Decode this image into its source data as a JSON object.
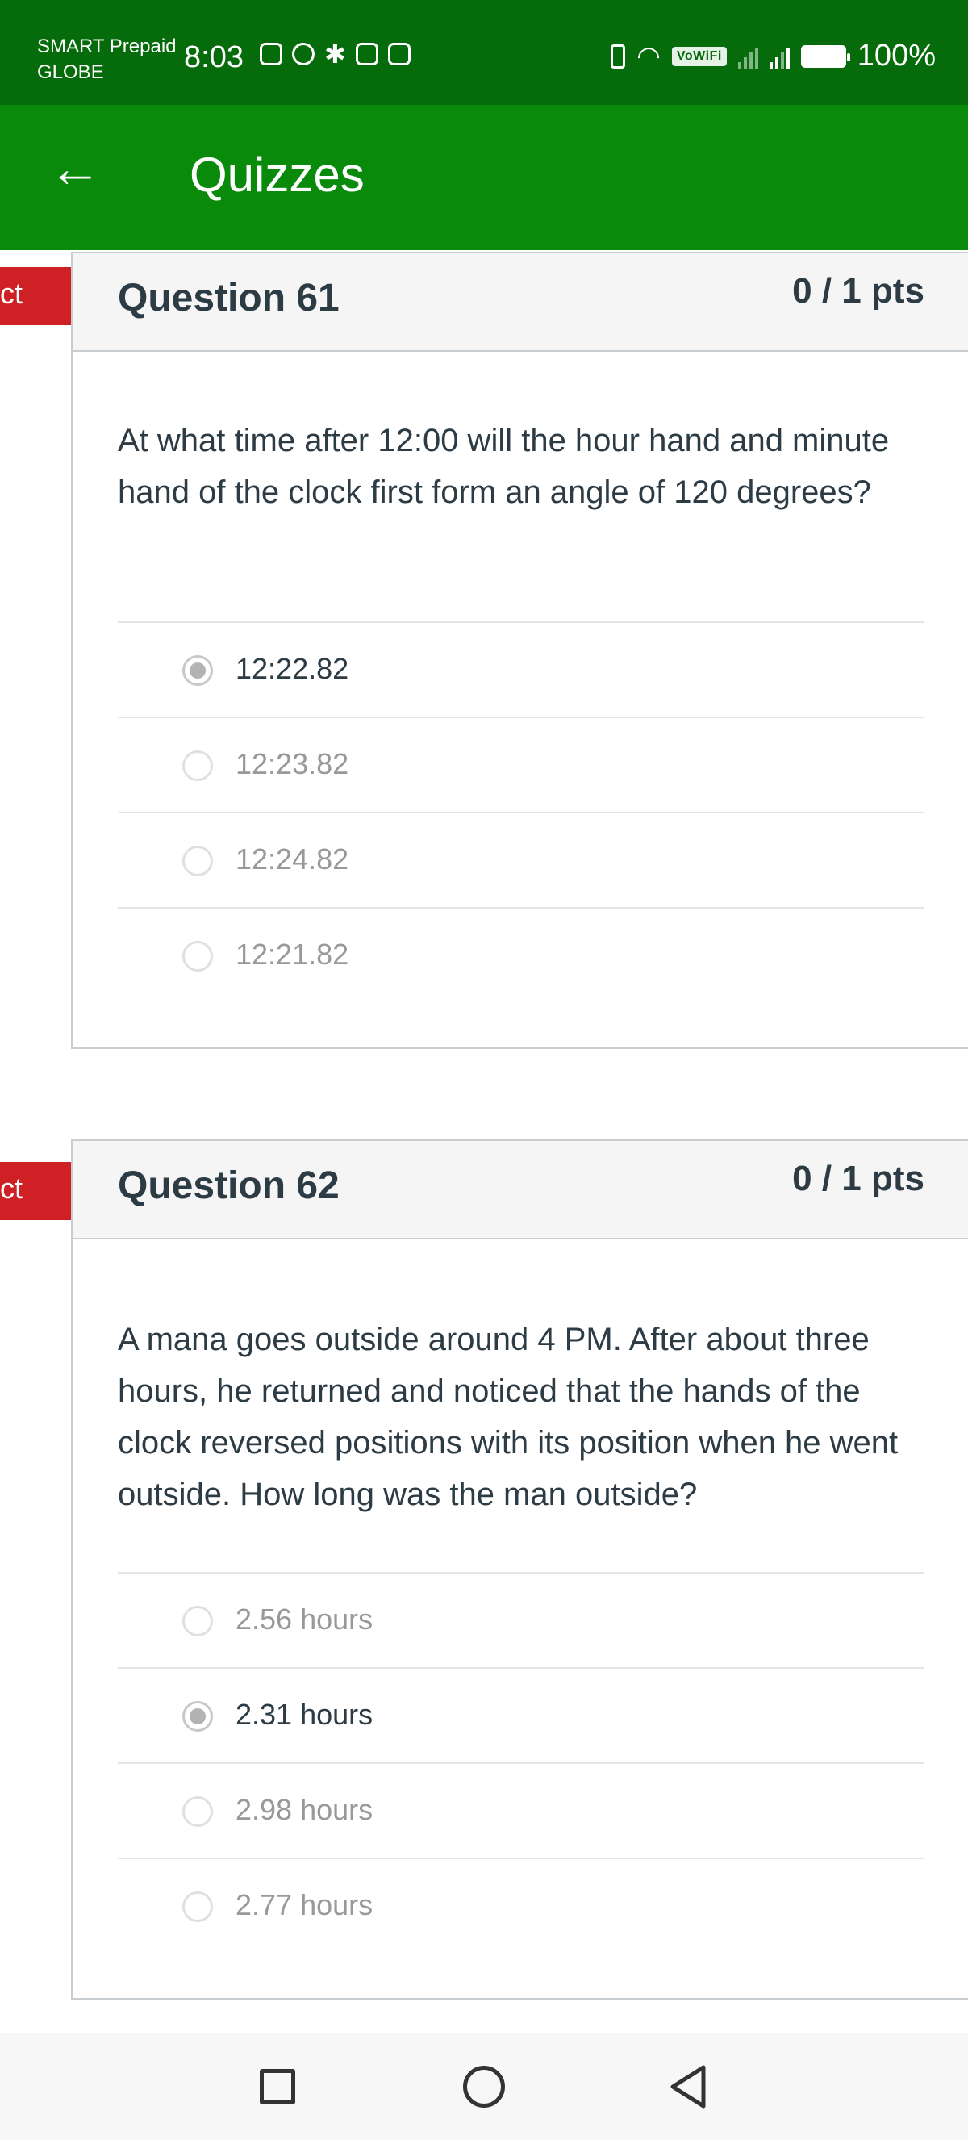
{
  "status_bar": {
    "carrier_line1": "SMART Prepaid",
    "carrier_line2": "GLOBE",
    "time": "8:03",
    "vowifi": "VoWiFi",
    "battery": "100%"
  },
  "app_bar": {
    "back_icon": "arrow-left-icon",
    "title": "Quizzes"
  },
  "ribbon_text": "ct",
  "questions": [
    {
      "name": "Question 61",
      "points": "0 / 1 pts",
      "text": "At what time after 12:00 will the hour hand and minute hand of the clock first form an angle of 120 degrees?",
      "answers": [
        {
          "label": "12:22.82",
          "selected": true
        },
        {
          "label": "12:23.82",
          "selected": false
        },
        {
          "label": "12:24.82",
          "selected": false
        },
        {
          "label": "12:21.82",
          "selected": false
        }
      ]
    },
    {
      "name": "Question 62",
      "points": "0 / 1 pts",
      "text": "A mana goes outside around 4 PM. After about three hours, he returned and noticed that the hands of the clock reversed positions with its position when he went outside. How long was the man outside?",
      "answers": [
        {
          "label": "2.56 hours",
          "selected": false
        },
        {
          "label": "2.31 hours",
          "selected": true
        },
        {
          "label": "2.98 hours",
          "selected": false
        },
        {
          "label": "2.77 hours",
          "selected": false
        }
      ]
    }
  ],
  "nav_bar": {
    "recents_icon": "square-recents-icon",
    "home_icon": "circle-home-icon",
    "back_icon": "triangle-back-icon"
  }
}
